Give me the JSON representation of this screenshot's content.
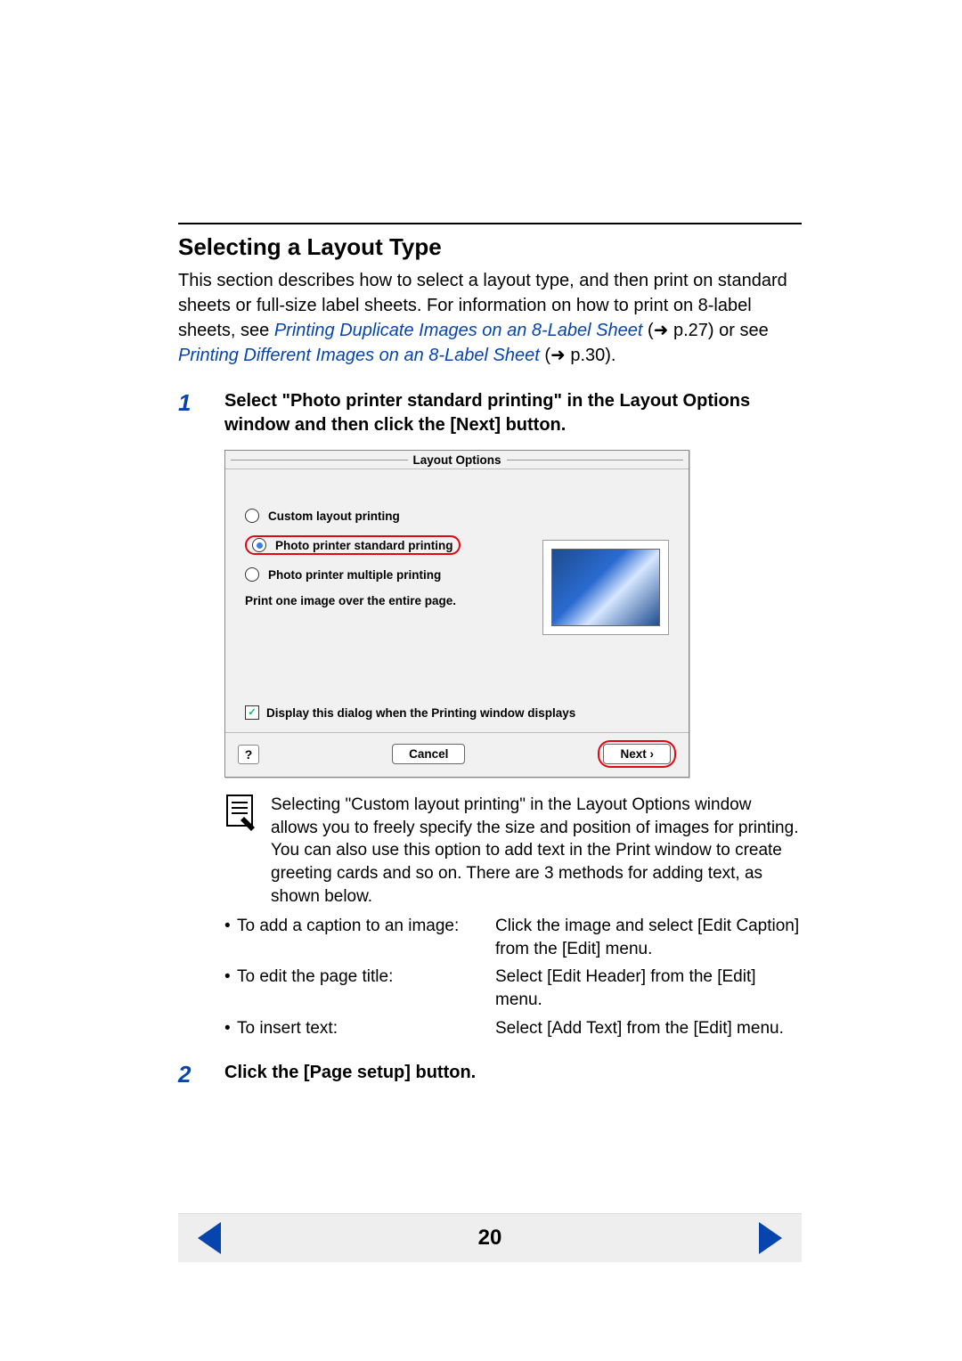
{
  "section": {
    "title": "Selecting a Layout Type",
    "intro_before_link1": "This section describes how to select a layout type, and then print on standard sheets or full-size label sheets. For information on how to print on 8-label sheets, see ",
    "link1": "Printing Duplicate Images on an 8-Label Sheet",
    "after_link1": " (➜ p.27) or see ",
    "link2": "Printing Different Images on an 8-Label Sheet",
    "after_link2": " (➜ p.30)."
  },
  "step1": {
    "num": "1",
    "text": "Select \"Photo printer standard printing\" in the Layout Options window and then click the [Next] button."
  },
  "dialog": {
    "title": "Layout Options",
    "opt1": "Custom layout printing",
    "opt2": "Photo printer standard printing",
    "opt3": "Photo printer multiple printing",
    "desc": "Print one image over the entire page.",
    "checkbox": "Display this dialog when the Printing window displays",
    "cancel": "Cancel",
    "next": "Next ›",
    "help": "?"
  },
  "note": {
    "text": "Selecting \"Custom layout printing\" in the Layout Options window allows you to freely specify the size and position of images for printing. You can also use this option to add text in the Print window to create greeting cards and so on. There are 3 methods for adding text, as shown below."
  },
  "bullets": {
    "b1_l": "To add a caption to an image:",
    "b1_r": "Click the image and select [Edit Caption] from the [Edit] menu.",
    "b2_l": "To edit the page title:",
    "b2_r": "Select [Edit Header] from the [Edit] menu.",
    "b3_l": "To insert text:",
    "b3_r": "Select [Add Text] from the [Edit] menu."
  },
  "step2": {
    "num": "2",
    "text": "Click the [Page setup] button."
  },
  "footer": {
    "page": "20"
  }
}
